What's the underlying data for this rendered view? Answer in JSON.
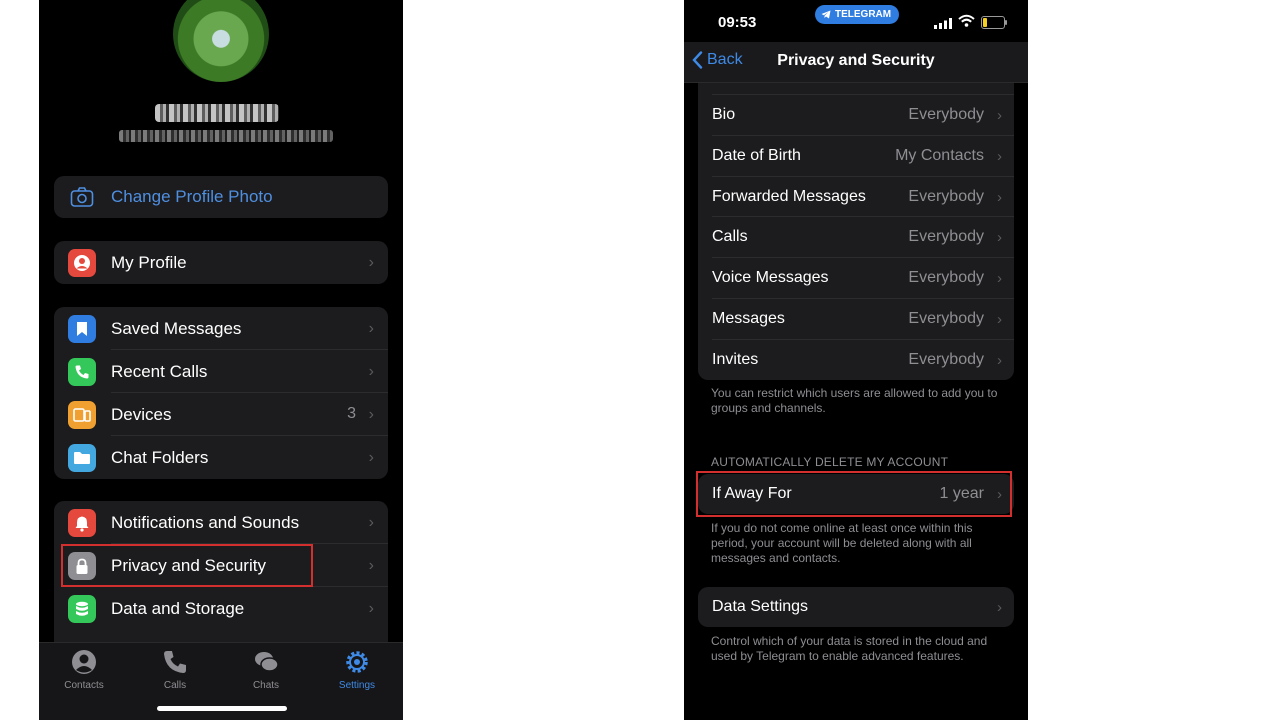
{
  "left_screen": {
    "change_photo_label": "Change Profile Photo",
    "my_profile": "My Profile",
    "group2": [
      {
        "label": "Saved Messages",
        "value": "",
        "icon": "bookmark-icon",
        "color": "#2f7de0"
      },
      {
        "label": "Recent Calls",
        "value": "",
        "icon": "phone-icon",
        "color": "#34c759"
      },
      {
        "label": "Devices",
        "value": "3",
        "icon": "devices-icon",
        "color": "#f0a030"
      },
      {
        "label": "Chat Folders",
        "value": "",
        "icon": "folder-icon",
        "color": "#44a8e0"
      }
    ],
    "group3": [
      {
        "label": "Notifications and Sounds",
        "icon": "bell-icon",
        "color": "#e5483c"
      },
      {
        "label": "Privacy and Security",
        "icon": "lock-icon",
        "color": "#8e8e93"
      },
      {
        "label": "Data and Storage",
        "icon": "database-icon",
        "color": "#34c759"
      }
    ],
    "tabs": [
      {
        "label": "Contacts",
        "icon": "person-circle-icon"
      },
      {
        "label": "Calls",
        "icon": "phone-icon"
      },
      {
        "label": "Chats",
        "icon": "chat-bubbles-icon"
      },
      {
        "label": "Settings",
        "icon": "gear-icon",
        "active": true
      }
    ]
  },
  "right_screen": {
    "time": "09:53",
    "telegram_pill": "TELEGRAM",
    "back_label": "Back",
    "title": "Privacy and Security",
    "rows": [
      {
        "label": "Bio",
        "value": "Everybody"
      },
      {
        "label": "Date of Birth",
        "value": "My Contacts"
      },
      {
        "label": "Forwarded Messages",
        "value": "Everybody"
      },
      {
        "label": "Calls",
        "value": "Everybody"
      },
      {
        "label": "Voice Messages",
        "value": "Everybody"
      },
      {
        "label": "Messages",
        "value": "Everybody"
      },
      {
        "label": "Invites",
        "value": "Everybody"
      }
    ],
    "invites_footer": "You can restrict which users are allowed to add you to groups and channels.",
    "auto_delete_header": "AUTOMATICALLY DELETE MY ACCOUNT",
    "if_away_label": "If Away For",
    "if_away_value": "1 year",
    "if_away_footer": "If you do not come online at least once within this period, your account will be deleted along with all messages and contacts.",
    "data_settings_label": "Data Settings",
    "data_settings_footer": "Control which of your data is stored in the cloud and used by Telegram to enable advanced features."
  },
  "colors": {
    "accent": "#3e8ae6",
    "highlight": "#d32f2f"
  }
}
